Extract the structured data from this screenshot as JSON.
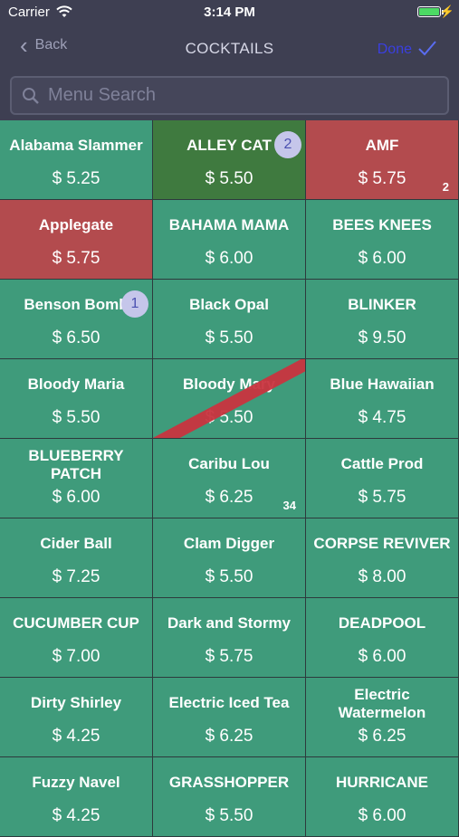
{
  "status_bar": {
    "carrier": "Carrier",
    "time": "3:14 PM",
    "battery_level": 1.0
  },
  "nav": {
    "back_label": "Back",
    "title": "COCKTAILS",
    "done_label": "Done"
  },
  "search": {
    "placeholder": "Menu Search"
  },
  "colors": {
    "green": "#3f9b7b",
    "red": "#b34b4e",
    "dark_green": "#3f7a3f"
  },
  "items": [
    {
      "name": "Alabama Slammer",
      "price": "$ 5.25",
      "style": "green"
    },
    {
      "name": "ALLEY CAT",
      "price": "$ 5.50",
      "style": "dark",
      "badge": "2"
    },
    {
      "name": "AMF",
      "price": "$ 5.75",
      "style": "red",
      "count": "2"
    },
    {
      "name": "Applegate",
      "price": "$ 5.75",
      "style": "red"
    },
    {
      "name": "BAHAMA MAMA",
      "price": "$ 6.00",
      "style": "green"
    },
    {
      "name": "BEES KNEES",
      "price": "$ 6.00",
      "style": "green"
    },
    {
      "name": "Benson Bomb",
      "price": "$ 6.50",
      "style": "green",
      "badge": "1"
    },
    {
      "name": "Black Opal",
      "price": "$ 5.50",
      "style": "green"
    },
    {
      "name": "BLINKER",
      "price": "$ 9.50",
      "style": "green"
    },
    {
      "name": "Bloody Maria",
      "price": "$ 5.50",
      "style": "green"
    },
    {
      "name": "Bloody Mary",
      "price": "$ 5.50",
      "style": "green",
      "strike": true
    },
    {
      "name": "Blue Hawaiian",
      "price": "$ 4.75",
      "style": "green"
    },
    {
      "name": "BLUEBERRY PATCH",
      "price": "$ 6.00",
      "style": "green"
    },
    {
      "name": "Caribu Lou",
      "price": "$ 6.25",
      "style": "green",
      "count": "34"
    },
    {
      "name": "Cattle Prod",
      "price": "$ 5.75",
      "style": "green"
    },
    {
      "name": "Cider Ball",
      "price": "$ 7.25",
      "style": "green"
    },
    {
      "name": "Clam Digger",
      "price": "$ 5.50",
      "style": "green"
    },
    {
      "name": "CORPSE REVIVER",
      "price": "$ 8.00",
      "style": "green"
    },
    {
      "name": "CUCUMBER CUP",
      "price": "$ 7.00",
      "style": "green"
    },
    {
      "name": "Dark and Stormy",
      "price": "$ 5.75",
      "style": "green"
    },
    {
      "name": "DEADPOOL",
      "price": "$ 6.00",
      "style": "green"
    },
    {
      "name": "Dirty Shirley",
      "price": "$ 4.25",
      "style": "green"
    },
    {
      "name": "Electric Iced Tea",
      "price": "$ 6.25",
      "style": "green"
    },
    {
      "name": "Electric Watermelon",
      "price": "$ 6.25",
      "style": "green"
    },
    {
      "name": "Fuzzy Navel",
      "price": "$ 4.25",
      "style": "green"
    },
    {
      "name": "GRASSHOPPER",
      "price": "$ 5.50",
      "style": "green"
    },
    {
      "name": "HURRICANE",
      "price": "$ 6.00",
      "style": "green"
    }
  ]
}
